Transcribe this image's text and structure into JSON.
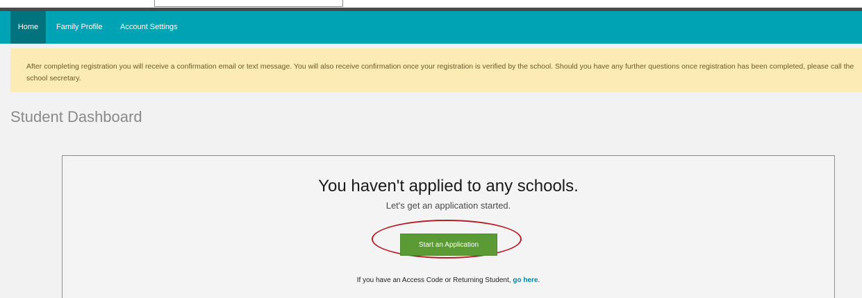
{
  "nav": {
    "items": [
      {
        "label": "Home",
        "active": true
      },
      {
        "label": "Family Profile",
        "active": false
      },
      {
        "label": "Account Settings",
        "active": false
      }
    ],
    "color": "#00a3b4",
    "active_color": "#00737f"
  },
  "alert": {
    "message": "After completing registration you will receive a confirmation email or text message. You will also receive confirmation once your registration is verified by the school. Should you have any further questions once registration has been completed, please call the school secretary.",
    "color": "#fcebb5"
  },
  "page": {
    "title": "Student Dashboard"
  },
  "empty_state": {
    "headline": "You haven't applied to any schools.",
    "subtext": "Let's get an application started.",
    "button_label": "Start an Application",
    "button_color": "#5b9a34",
    "highlight_color": "#b51d26",
    "access_text": "If you have an Access Code or Returning Student, ",
    "access_link": "go here",
    "access_punct": "."
  }
}
